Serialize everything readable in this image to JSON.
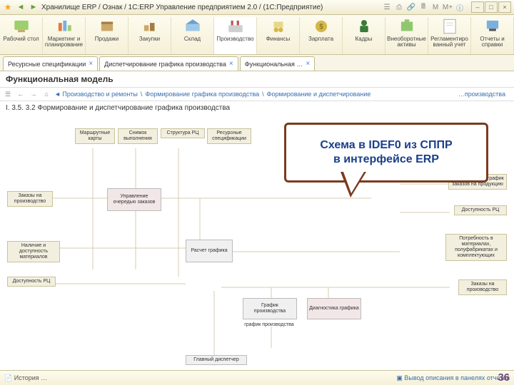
{
  "titlebar": {
    "title": "Хранилище ERP / Ознак / 1C:ERP Управление предприятием 2.0 / (1C:Предприятие)"
  },
  "toolitems": [
    {
      "label": "Рабочий стол"
    },
    {
      "label": "Маркетинг и планирование"
    },
    {
      "label": "Продажи"
    },
    {
      "label": "Закупки"
    },
    {
      "label": "Склад"
    },
    {
      "label": "Производство"
    },
    {
      "label": "Финансы"
    },
    {
      "label": "Зарплата"
    },
    {
      "label": "Кадры"
    },
    {
      "label": "Внеоборотные активы"
    },
    {
      "label": "Регламентированный учет"
    },
    {
      "label": "Отчеты и справки"
    }
  ],
  "tabs": [
    {
      "label": "Ресурсные спецификации"
    },
    {
      "label": "Диспетчирование графика производства"
    },
    {
      "label": "Функциональная …"
    }
  ],
  "header": "Функциональная модель",
  "crumb": {
    "parts": [
      "Производство и ремонты",
      "Формирование графика производства",
      "Формирование и диспетчирование",
      "…производства"
    ]
  },
  "section": "I. 3.5. 3.2 Формирование и диспетчирование графика производства",
  "boxes": {
    "top1": "Маршрутные карты",
    "top2": "Снимок выполнения",
    "top3": "Структура РЦ",
    "top4": "Ресурсные спецификации",
    "l1": "Заказы на производство",
    "l2": "Наличие и доступность материалов",
    "l3": "Доступность РЦ",
    "c1": "Управление очередью заказов",
    "c2": "Расчет графика",
    "c3": "График производства",
    "c4": "Диагностика графика",
    "r1": "Утвержденный график заказов на продукцию",
    "r2": "Доступность РЦ",
    "r3": "Потребность в материалах, полуфабрикатах и комплектующих",
    "r4": "Заказы на производство",
    "b1": "график производства",
    "b2": "Главный диспетчер"
  },
  "callout": {
    "l1": "Схема в IDEF0 из СППР",
    "l2": "в интерфейсе ERP"
  },
  "statusbar": {
    "left": "История …",
    "right": "Вывод описания в панелях отчетов"
  },
  "slidenum": "36"
}
